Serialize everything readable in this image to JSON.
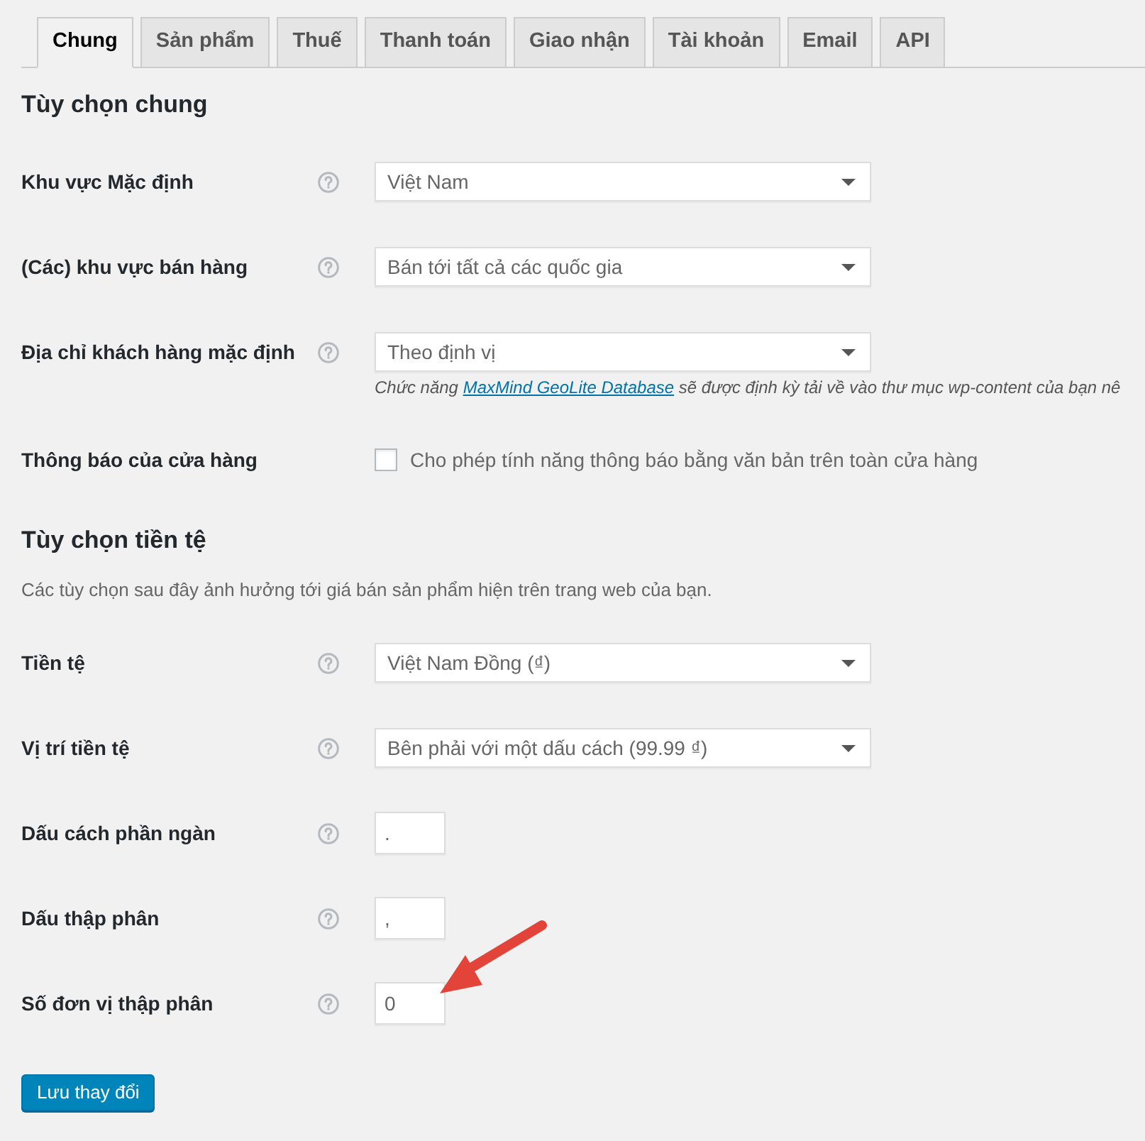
{
  "tabs": [
    {
      "label": "Chung",
      "selected": true
    },
    {
      "label": "Sản phẩm",
      "selected": false
    },
    {
      "label": "Thuế",
      "selected": false
    },
    {
      "label": "Thanh toán",
      "selected": false
    },
    {
      "label": "Giao nhận",
      "selected": false
    },
    {
      "label": "Tài khoản",
      "selected": false
    },
    {
      "label": "Email",
      "selected": false
    },
    {
      "label": "API",
      "selected": false
    }
  ],
  "sections": [
    {
      "title": "Tùy chọn chung",
      "fields": [
        {
          "kind": "select",
          "label": "Khu vực Mặc định",
          "help": true,
          "value": "Việt Nam"
        },
        {
          "kind": "select",
          "label": "(Các) khu vực bán hàng",
          "help": true,
          "value": "Bán tới tất cả các quốc gia"
        },
        {
          "kind": "select",
          "label": "Địa chỉ khách hàng mặc định",
          "help": true,
          "value": "Theo định vị",
          "note": {
            "before": "Chức năng",
            "link": "MaxMind GeoLite Database",
            "after": "sẽ được định kỳ tải về vào thư mục wp-content của bạn nê"
          }
        },
        {
          "kind": "checkbox",
          "label": "Thông báo của cửa hàng",
          "help": false,
          "checked": false,
          "text": "Cho phép tính năng thông báo bằng văn bản trên toàn cửa hàng"
        }
      ]
    },
    {
      "title": "Tùy chọn tiền tệ",
      "description": "Các tùy chọn sau đây ảnh hưởng tới giá bán sản phẩm hiện trên trang web của bạn.",
      "fields": [
        {
          "kind": "select",
          "label": "Tiền tệ",
          "help": true,
          "value": "Việt Nam Đồng (₫)"
        },
        {
          "kind": "select",
          "label": "Vị trí tiền tệ",
          "help": true,
          "value": "Bên phải với một dấu cách (99.99 ₫)"
        },
        {
          "kind": "text",
          "label": "Dấu cách phần ngàn",
          "help": true,
          "value": "."
        },
        {
          "kind": "text",
          "label": "Dấu thập phân",
          "help": true,
          "value": ","
        },
        {
          "kind": "text",
          "label": "Số đơn vị thập phân",
          "help": true,
          "value": "0"
        }
      ]
    }
  ],
  "save_button": "Lưu thay đổi"
}
